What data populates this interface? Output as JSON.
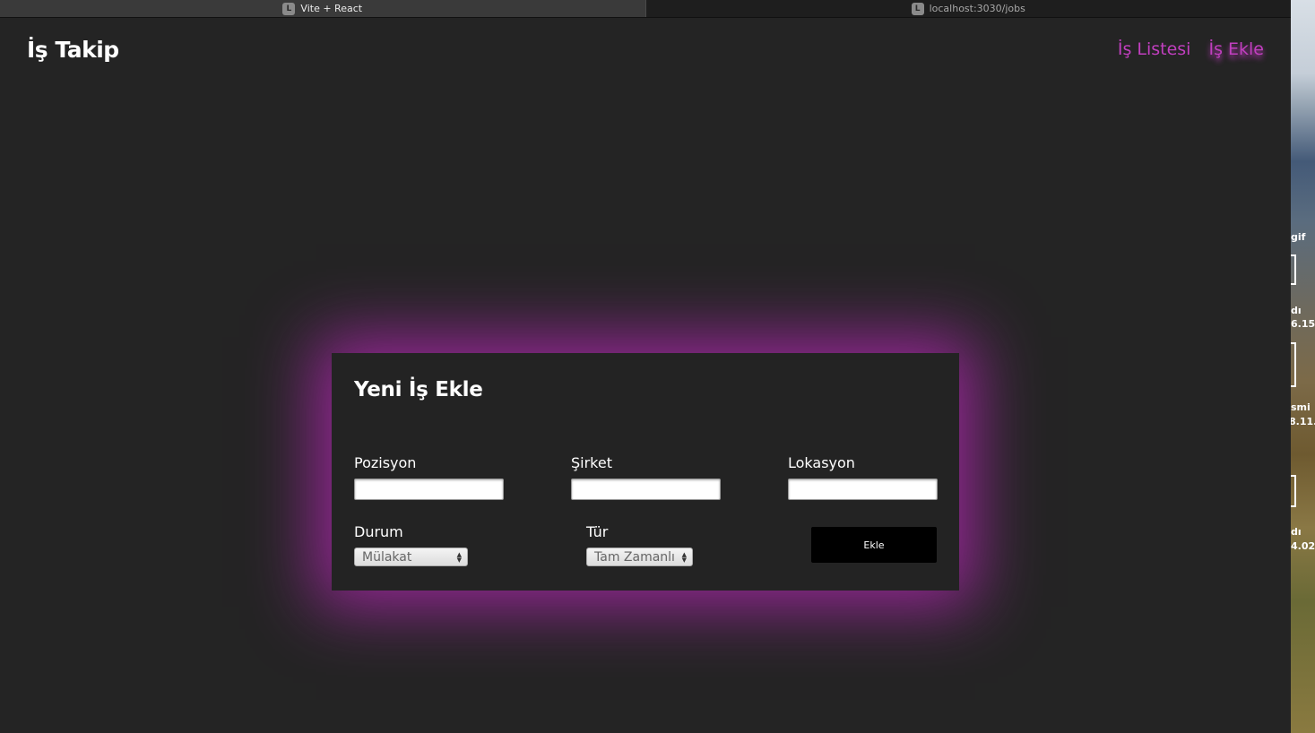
{
  "browser": {
    "tabs": [
      {
        "favicon": "L",
        "title": "Vite + React",
        "active": true
      },
      {
        "favicon": "L",
        "title": "localhost:3030/jobs",
        "active": false
      }
    ]
  },
  "header": {
    "brand": "İş Takip",
    "nav": [
      {
        "label": "İş Listesi",
        "active": false
      },
      {
        "label": "İş Ekle",
        "active": true
      }
    ]
  },
  "form": {
    "title": "Yeni İş Ekle",
    "fields": {
      "position": {
        "label": "Pozisyon",
        "value": ""
      },
      "company": {
        "label": "Şirket",
        "value": ""
      },
      "location": {
        "label": "Lokasyon",
        "value": ""
      }
    },
    "status": {
      "label": "Durum",
      "selected": "Mülakat"
    },
    "type": {
      "label": "Tür",
      "selected": "Tam Zamanlı"
    },
    "submit_label": "Ekle"
  },
  "desktop": {
    "labels": [
      "gif",
      "dı",
      "6.15",
      "smi",
      "8.11.",
      "dı",
      "4.02"
    ]
  },
  "colors": {
    "accent": "#c13fbf",
    "background": "#242424",
    "glow": "#be28be"
  }
}
